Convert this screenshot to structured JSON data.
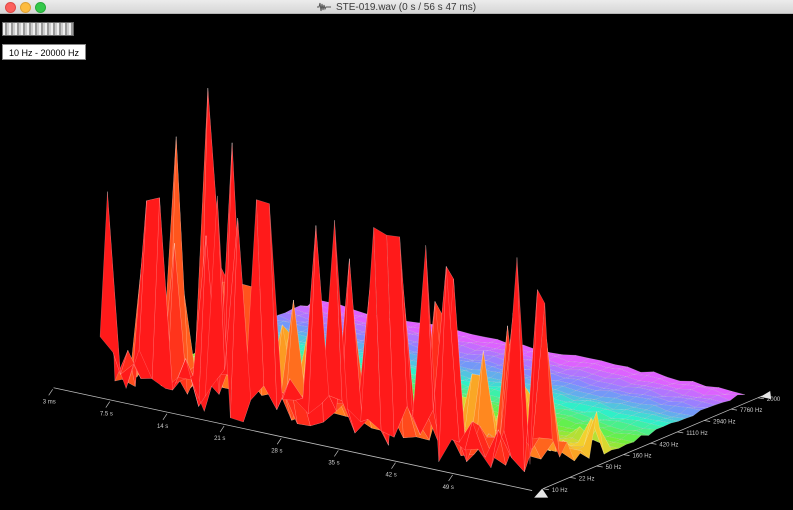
{
  "window": {
    "title": "STE-019.wav (0 s / 56 s 47 ms)",
    "title_icon": "waveform-icon"
  },
  "toolbar": {
    "range_label": "10 Hz - 20000 Hz"
  },
  "chart_data": {
    "type": "3d-spectrogram",
    "time_axis": {
      "ticks": [
        "3 ms",
        "7.5 s",
        "14 s",
        "21 s",
        "28 s",
        "35 s",
        "42 s",
        "49 s"
      ]
    },
    "freq_axis": {
      "ticks": [
        "10 Hz",
        "22 Hz",
        "50 Hz",
        "160 Hz",
        "420 Hz",
        "1110 Hz",
        "2940 Hz",
        "7760 Hz",
        "2000"
      ],
      "scale": "log"
    },
    "colormap": [
      "#ff1a1a",
      "#ff8a1f",
      "#f2d32e",
      "#6cf03a",
      "#2ff0c8",
      "#7d8cff",
      "#e060ff"
    ]
  }
}
